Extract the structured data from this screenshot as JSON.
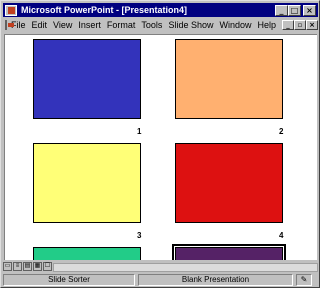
{
  "window": {
    "title": "Microsoft PowerPoint - [Presentation4]",
    "minimize_glyph": "_",
    "maximize_glyph": "□",
    "close_glyph": "×"
  },
  "menubar": {
    "items": [
      "File",
      "Edit",
      "View",
      "Insert",
      "Format",
      "Tools",
      "Slide Show",
      "Window",
      "Help"
    ],
    "doc_minimize_glyph": "_",
    "doc_restore_glyph": "▫",
    "doc_close_glyph": "×"
  },
  "slides": [
    {
      "number": "1",
      "color": "#3333bb"
    },
    {
      "number": "2",
      "color": "#ffb070"
    },
    {
      "number": "3",
      "color": "#ffff77"
    },
    {
      "number": "4",
      "color": "#dd1111"
    },
    {
      "number": "",
      "color": "#22cc88"
    },
    {
      "number": "",
      "color": "#552266"
    }
  ],
  "status": {
    "view": "Slide Sorter",
    "design": "Blank Presentation",
    "spell_icon": "✎"
  },
  "view_buttons": [
    "▭",
    "≡",
    "▤",
    "▦",
    "☐"
  ]
}
